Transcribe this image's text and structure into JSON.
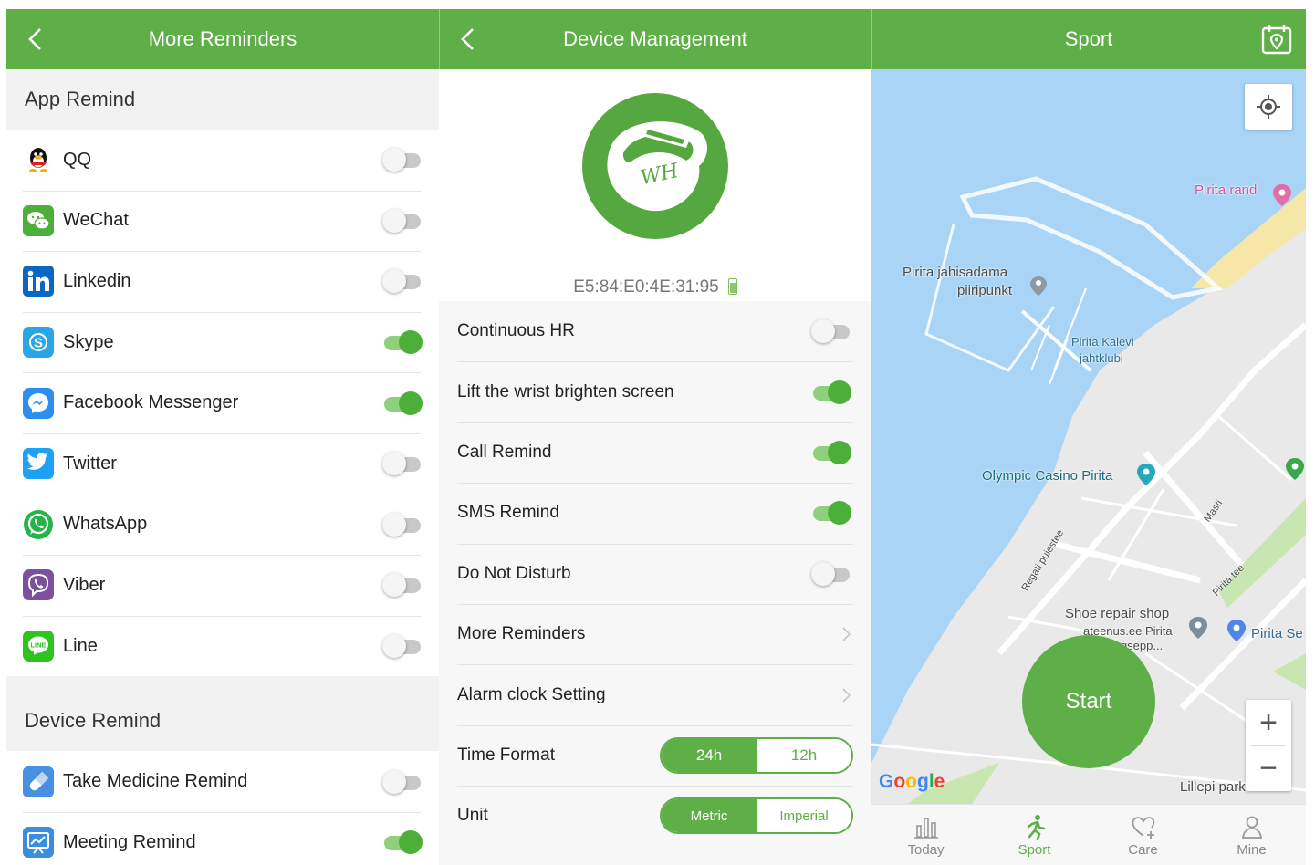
{
  "panel1": {
    "title": "More Reminders",
    "app_section": "App Remind",
    "apps": [
      {
        "label": "QQ",
        "icon": "qq-icon",
        "on": false
      },
      {
        "label": "WeChat",
        "icon": "wechat-icon",
        "on": false
      },
      {
        "label": "Linkedin",
        "icon": "linkedin-icon",
        "on": false
      },
      {
        "label": "Skype",
        "icon": "skype-icon",
        "on": true
      },
      {
        "label": "Facebook Messenger",
        "icon": "messenger-icon",
        "on": true
      },
      {
        "label": "Twitter",
        "icon": "twitter-icon",
        "on": false
      },
      {
        "label": "WhatsApp",
        "icon": "whatsapp-icon",
        "on": false
      },
      {
        "label": "Viber",
        "icon": "viber-icon",
        "on": false
      },
      {
        "label": "Line",
        "icon": "line-icon",
        "on": false
      }
    ],
    "device_section": "Device Remind",
    "device": [
      {
        "label": "Take Medicine Remind",
        "icon": "medicine-icon",
        "on": false
      },
      {
        "label": "Meeting Remind",
        "icon": "meeting-icon",
        "on": true
      }
    ]
  },
  "panel2": {
    "title": "Device Management",
    "logo_text": "WH",
    "mac": "E5:84:E0:4E:31:95",
    "settings": [
      {
        "label": "Continuous HR",
        "kind": "toggle",
        "on": false
      },
      {
        "label": "Lift the wrist brighten screen",
        "kind": "toggle",
        "on": true
      },
      {
        "label": "Call Remind",
        "kind": "toggle",
        "on": true
      },
      {
        "label": "SMS Remind",
        "kind": "toggle",
        "on": true
      },
      {
        "label": "Do Not Disturb",
        "kind": "toggle",
        "on": false
      },
      {
        "label": "More Reminders",
        "kind": "link"
      },
      {
        "label": "Alarm clock Setting",
        "kind": "link"
      }
    ],
    "time_format": {
      "label": "Time Format",
      "options": [
        "24h",
        "12h"
      ],
      "selected": "24h"
    },
    "unit": {
      "label": "Unit",
      "options": [
        "Metric",
        "Imperial"
      ],
      "selected": "Metric"
    }
  },
  "panel3": {
    "title": "Sport",
    "start_label": "Start",
    "google_label": "Google",
    "map_labels": {
      "pirita_rand": "Pirita rand",
      "jahisadama_1": "Pirita jahisadama",
      "jahisadama_2": "piiripunkt",
      "kalevi_1": "Pirita Kalevi",
      "kalevi_2": "jahtklubi",
      "casino": "Olympic Casino Pirita",
      "masti": "Masti",
      "regati": "Regati puiestee",
      "pirita_tee": "Pirita tee",
      "shoe_1": "Shoe repair shop",
      "shoe_2": "ateenus.ee Pirita",
      "shoe_3": "...ingsepp...",
      "pirita_se": "Pirita Se",
      "lillepi": "Lillepi park"
    },
    "zoom_in": "+",
    "zoom_out": "−",
    "tabs": [
      {
        "label": "Today",
        "icon": "bar-chart-icon",
        "active": false
      },
      {
        "label": "Sport",
        "icon": "running-icon",
        "active": true
      },
      {
        "label": "Care",
        "icon": "heart-plus-icon",
        "active": false
      },
      {
        "label": "Mine",
        "icon": "person-icon",
        "active": false
      }
    ]
  },
  "colors": {
    "brand_green": "#5eaf47",
    "map_water": "#a9d4f5",
    "map_land": "#e8e8e8"
  }
}
